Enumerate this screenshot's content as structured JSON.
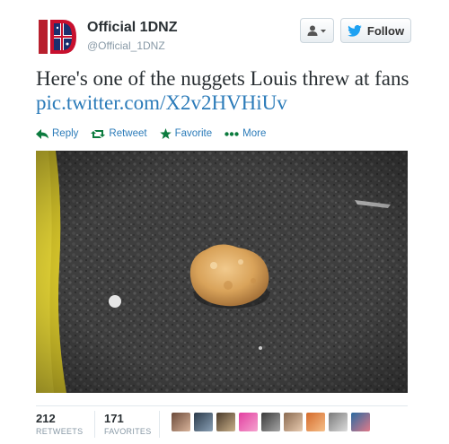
{
  "header": {
    "display_name": "Official 1DNZ",
    "handle": "@Official_1DNZ",
    "follow_label": "Follow"
  },
  "tweet": {
    "text": "Here's one of the nuggets Louis threw at fans",
    "link": "pic.twitter.com/X2v2HVHiUv"
  },
  "actions": {
    "reply": "Reply",
    "retweet": "Retweet",
    "favorite": "Favorite",
    "more": "More"
  },
  "stats": {
    "retweets_count": "212",
    "retweets_label": "RETWEETS",
    "favorites_count": "171",
    "favorites_label": "FAVORITES"
  },
  "colors": {
    "link": "#2b7bb9",
    "action": "#2b7bb9",
    "follow_bird": "#1da1f2"
  },
  "favoriters": [
    "avatar-1",
    "avatar-2",
    "avatar-3",
    "avatar-4",
    "avatar-5",
    "avatar-6",
    "avatar-7",
    "avatar-8",
    "avatar-9",
    "avatar-10"
  ]
}
